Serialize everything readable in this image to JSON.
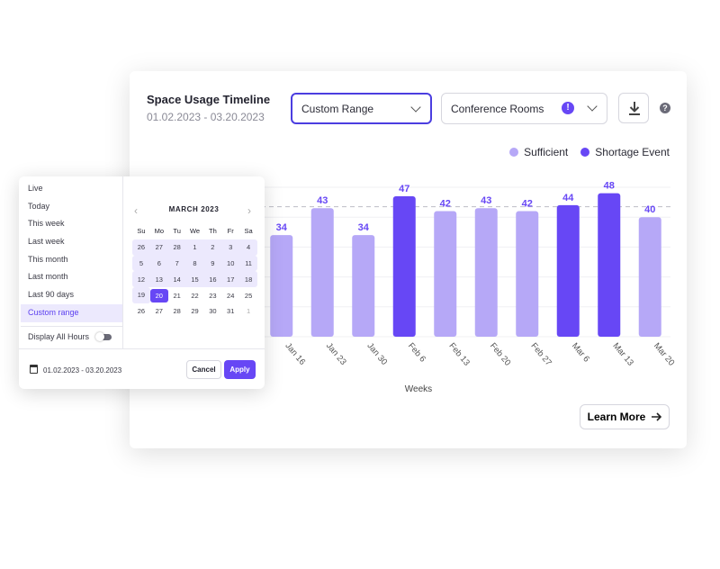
{
  "card": {
    "title": "Space Usage Timeline",
    "subtitle": "01.02.2023 - 03.20.2023",
    "range_select": "Custom Range",
    "room_select": "Conference Rooms",
    "room_warning": "!",
    "help": "?",
    "learn_more": "Learn More"
  },
  "colors": {
    "sufficient": "#b6a8f7",
    "shortage": "#6747f5",
    "accent": "#4b3ee0"
  },
  "chart_data": {
    "type": "bar",
    "categories": [
      "Jan 16",
      "Jan 23",
      "Jan 30",
      "Feb 6",
      "Feb 13",
      "Feb 20",
      "Feb 27",
      "Mar 6",
      "Mar 13",
      "Mar 20"
    ],
    "values": [
      34,
      43,
      34,
      47,
      42,
      43,
      42,
      44,
      48,
      40
    ],
    "status": [
      "Sufficient",
      "Sufficient",
      "Sufficient",
      "Shortage Event",
      "Sufficient",
      "Sufficient",
      "Sufficient",
      "Shortage Event",
      "Shortage Event",
      "Sufficient"
    ],
    "xlabel": "Weeks",
    "ylim": [
      0,
      50
    ],
    "threshold": 43.5,
    "grid": true,
    "legend": {
      "position": "top-right",
      "items": [
        "Sufficient",
        "Shortage Event"
      ]
    }
  },
  "popup": {
    "presets": [
      "Live",
      "Today",
      "This week",
      "Last week",
      "This month",
      "Last month",
      "Last 90 days",
      "Custom range"
    ],
    "selected_preset": 7,
    "display_all_hours": "Display All Hours",
    "display_all_hours_on": false,
    "month": "MARCH 2023",
    "weekdays": [
      "Su",
      "Mo",
      "Tu",
      "We",
      "Th",
      "Fr",
      "Sa"
    ],
    "weeks": [
      [
        [
          "26",
          "inr"
        ],
        [
          "27",
          "inr"
        ],
        [
          "28",
          "inr"
        ],
        [
          "1",
          "inr"
        ],
        [
          "2",
          "inr"
        ],
        [
          "3",
          "inr"
        ],
        [
          "4",
          "inr"
        ]
      ],
      [
        [
          "5",
          "inr"
        ],
        [
          "6",
          "inr"
        ],
        [
          "7",
          "inr"
        ],
        [
          "8",
          "inr"
        ],
        [
          "9",
          "inr"
        ],
        [
          "10",
          "inr"
        ],
        [
          "11",
          "inr"
        ]
      ],
      [
        [
          "12",
          "inr"
        ],
        [
          "13",
          "inr"
        ],
        [
          "14",
          "inr"
        ],
        [
          "15",
          "inr"
        ],
        [
          "16",
          "inr"
        ],
        [
          "17",
          "inr"
        ],
        [
          "18",
          "inr"
        ]
      ],
      [
        [
          "19",
          "inr"
        ],
        [
          "20",
          "sel"
        ],
        [
          "21",
          ""
        ],
        [
          "22",
          ""
        ],
        [
          "23",
          ""
        ],
        [
          "24",
          ""
        ],
        [
          "25",
          ""
        ]
      ],
      [
        [
          "26",
          ""
        ],
        [
          "27",
          ""
        ],
        [
          "28",
          ""
        ],
        [
          "29",
          ""
        ],
        [
          "30",
          ""
        ],
        [
          "31",
          ""
        ],
        [
          "1",
          "mut"
        ]
      ]
    ],
    "range_text": "01.02.2023 - 03.20.2023",
    "cancel": "Cancel",
    "apply": "Apply"
  }
}
